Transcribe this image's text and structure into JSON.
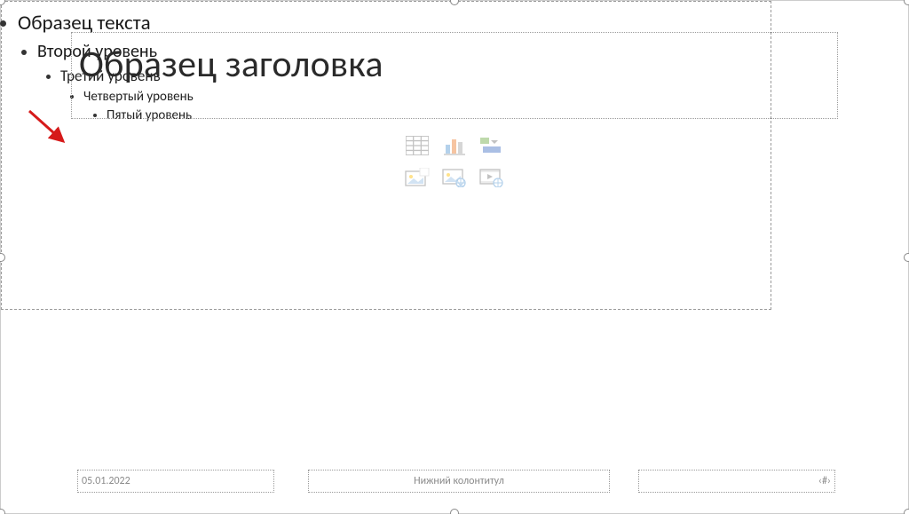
{
  "title_placeholder": {
    "text": "Образец заголовка"
  },
  "body_placeholder": {
    "level1": "Образец текста",
    "level2": "Второй уровень",
    "level3": "Третий уровень",
    "level4": "Четвертый уровень",
    "level5": "Пятый уровень",
    "content_icons": {
      "table": "insert-table-icon",
      "chart": "insert-chart-icon",
      "smartart": "insert-smartart-icon",
      "picture": "insert-picture-icon",
      "online_picture": "insert-online-picture-icon",
      "video": "insert-video-icon"
    }
  },
  "footer": {
    "date": "05.01.2022",
    "text": "Нижний колонтитул",
    "slide_number": "‹#›"
  },
  "colors": {
    "dotted_border": "#9a9a9a",
    "handle_border": "#888888",
    "footer_text": "#8a8a8a",
    "annotation_arrow": "#d61a1a"
  }
}
